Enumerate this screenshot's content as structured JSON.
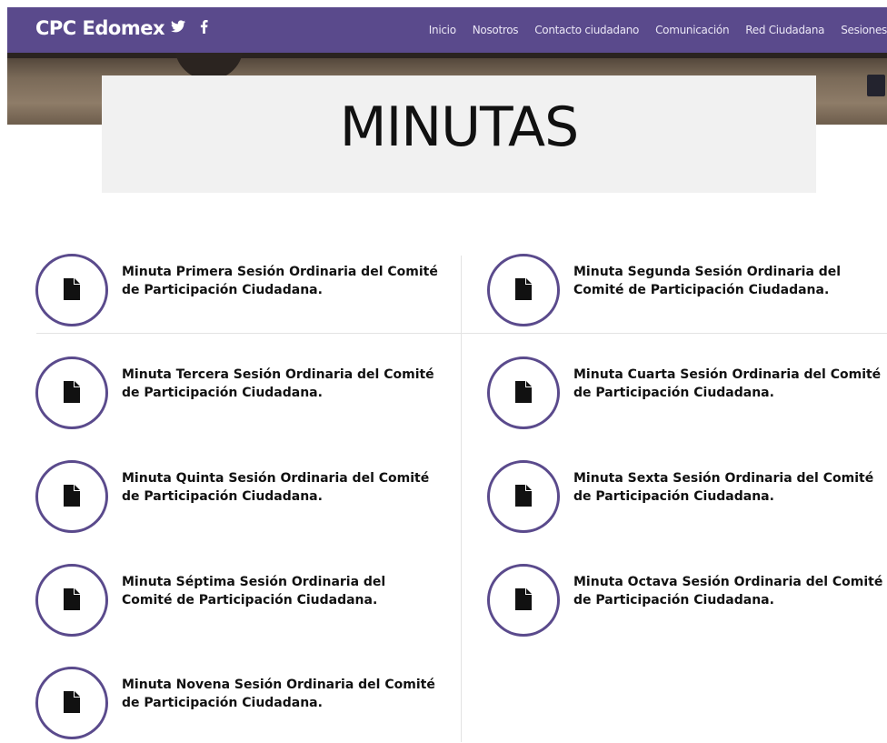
{
  "header": {
    "brand": "CPC Edomex",
    "social": [
      "twitter-icon",
      "facebook-icon"
    ],
    "nav": [
      "Inicio",
      "Nosotros",
      "Contacto ciudadano",
      "Comunicación",
      "Red Ciudadana",
      "Sesiones"
    ]
  },
  "page": {
    "title": "MINUTAS"
  },
  "minutas": [
    "Minuta Primera Sesión Ordinaria del Comité de Participación Ciudadana.",
    "Minuta Segunda Sesión Ordinaria del Comité de Participación Ciudadana.",
    "Minuta Tercera Sesión Ordinaria del Comité de Participación Ciudadana.",
    "Minuta Cuarta Sesión Ordinaria del Comité de Participación Ciudadana.",
    "Minuta Quinta Sesión Ordinaria del Comité de Participación Ciudadana.",
    "Minuta Sexta Sesión Ordinaria del Comité de Participación Ciudadana.",
    "Minuta Séptima Sesión Ordinaria del Comité de Participación Ciudadana.",
    "Minuta Octava Sesión Ordinaria del Comité de Participación Ciudadana.",
    "Minuta Novena Sesión Ordinaria del Comité de Participación Ciudadana."
  ],
  "colors": {
    "brand": "#5a4a8c",
    "title_box": "#f1f1f1"
  }
}
